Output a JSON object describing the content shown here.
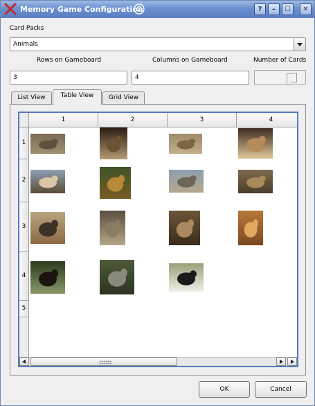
{
  "window": {
    "title": "Memory Game Configuration",
    "buttons": [
      "?",
      "–",
      "☐",
      "✕"
    ]
  },
  "card_packs": {
    "label": "Card Packs",
    "selected": "Animals"
  },
  "rows": {
    "label": "Rows on Gameboard",
    "value": "3"
  },
  "columns": {
    "label": "Columns on Gameboard",
    "value": "4"
  },
  "number_of_cards": {
    "label": "Number of Cards"
  },
  "tabs": [
    "List View",
    "Table View",
    "Grid View"
  ],
  "active_tab": "Table View",
  "table": {
    "column_headers": [
      "1",
      "2",
      "3",
      "4"
    ],
    "row_headers": [
      "1",
      "2",
      "3",
      "4",
      "5"
    ],
    "cards": [
      {
        "animal": "armadillo",
        "colors": [
          "#7a6a55",
          "#5d5240",
          "#a09070"
        ]
      },
      {
        "animal": "antelope-horns",
        "colors": [
          "#2a1c12",
          "#6b5234",
          "#b59a72"
        ]
      },
      {
        "animal": "running-antelope",
        "colors": [
          "#9d8a6a",
          "#7c6644",
          "#c2b08a"
        ]
      },
      {
        "animal": "bear",
        "colors": [
          "#3e2c20",
          "#b58b5c",
          "#e0c79a"
        ]
      },
      {
        "animal": "oryx",
        "colors": [
          "#8fa0b5",
          "#d8c7a5",
          "#5b4a35"
        ]
      },
      {
        "animal": "giraffe",
        "colors": [
          "#3d5528",
          "#b78a3a",
          "#7a5a25"
        ]
      },
      {
        "animal": "hippo-water",
        "colors": [
          "#8aa0b0",
          "#6d6558",
          "#b9a58b"
        ]
      },
      {
        "animal": "lion-resting",
        "colors": [
          "#7c6a4c",
          "#a88a5a",
          "#4c3e2c"
        ]
      },
      {
        "animal": "jackal",
        "colors": [
          "#b8a47e",
          "#3d3228",
          "#8c6a44"
        ]
      },
      {
        "animal": "baboon",
        "colors": [
          "#5a5040",
          "#8a7c62",
          "#b6a688"
        ]
      },
      {
        "animal": "kudu",
        "colors": [
          "#6b5538",
          "#a98a60",
          "#3a2c1c"
        ]
      },
      {
        "animal": "lion",
        "colors": [
          "#b8783a",
          "#e0a860",
          "#7a4820"
        ]
      },
      {
        "animal": "sable-antelope",
        "colors": [
          "#2c3a1c",
          "#1c1410",
          "#8a9a6a"
        ]
      },
      {
        "animal": "vervet-monkey",
        "colors": [
          "#4c5a38",
          "#8a8a7a",
          "#2c3420"
        ]
      },
      {
        "animal": "zebra",
        "colors": [
          "#98a078",
          "#1a1a1a",
          "#f0f0e8"
        ]
      }
    ]
  },
  "buttons": {
    "ok": "OK",
    "cancel": "Cancel"
  }
}
